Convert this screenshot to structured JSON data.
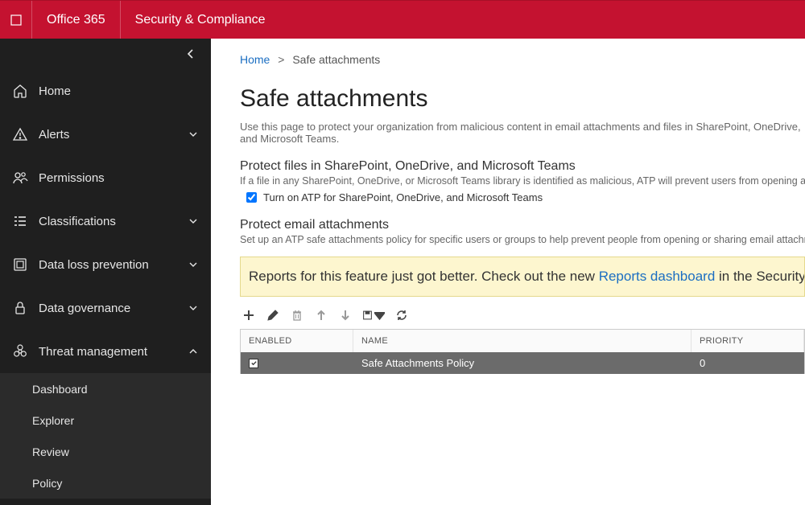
{
  "topbar": {
    "brand": "Office 365",
    "appname": "Security & Compliance"
  },
  "sidebar": {
    "items": [
      {
        "label": "Home",
        "expandable": false
      },
      {
        "label": "Alerts",
        "expandable": true
      },
      {
        "label": "Permissions",
        "expandable": false
      },
      {
        "label": "Classifications",
        "expandable": true
      },
      {
        "label": "Data loss prevention",
        "expandable": true
      },
      {
        "label": "Data governance",
        "expandable": true
      },
      {
        "label": "Threat management",
        "expandable": true,
        "expanded": true
      }
    ],
    "threat_children": [
      {
        "label": "Dashboard"
      },
      {
        "label": "Explorer"
      },
      {
        "label": "Review"
      },
      {
        "label": "Policy"
      }
    ]
  },
  "breadcrumb": {
    "home": "Home",
    "sep": ">",
    "current": "Safe attachments"
  },
  "page": {
    "title": "Safe attachments",
    "desc": "Use this page to protect your organization from malicious content in email attachments and files in SharePoint, OneDrive, and Microsoft Teams."
  },
  "section1": {
    "head": "Protect files in SharePoint, OneDrive, and Microsoft Teams",
    "sub": "If a file in any SharePoint, OneDrive, or Microsoft Teams library is identified as malicious, ATP will prevent users from opening and downloading the file.",
    "atp_label": "Turn on ATP for SharePoint, OneDrive, and Microsoft Teams",
    "atp_checked": true
  },
  "section2": {
    "head": "Protect email attachments",
    "sub": "Set up an ATP safe attachments policy for specific users or groups to help prevent people from opening or sharing email attachments that contain malicious content."
  },
  "banner": {
    "pre": "Reports for this feature just got better. Check out the new ",
    "link": "Reports dashboard",
    "post": " in the Security and Compliance Center."
  },
  "grid": {
    "headers": {
      "enabled": "ENABLED",
      "name": "NAME",
      "priority": "PRIORITY"
    },
    "rows": [
      {
        "enabled": true,
        "name": "Safe Attachments Policy",
        "priority": "0"
      }
    ]
  }
}
